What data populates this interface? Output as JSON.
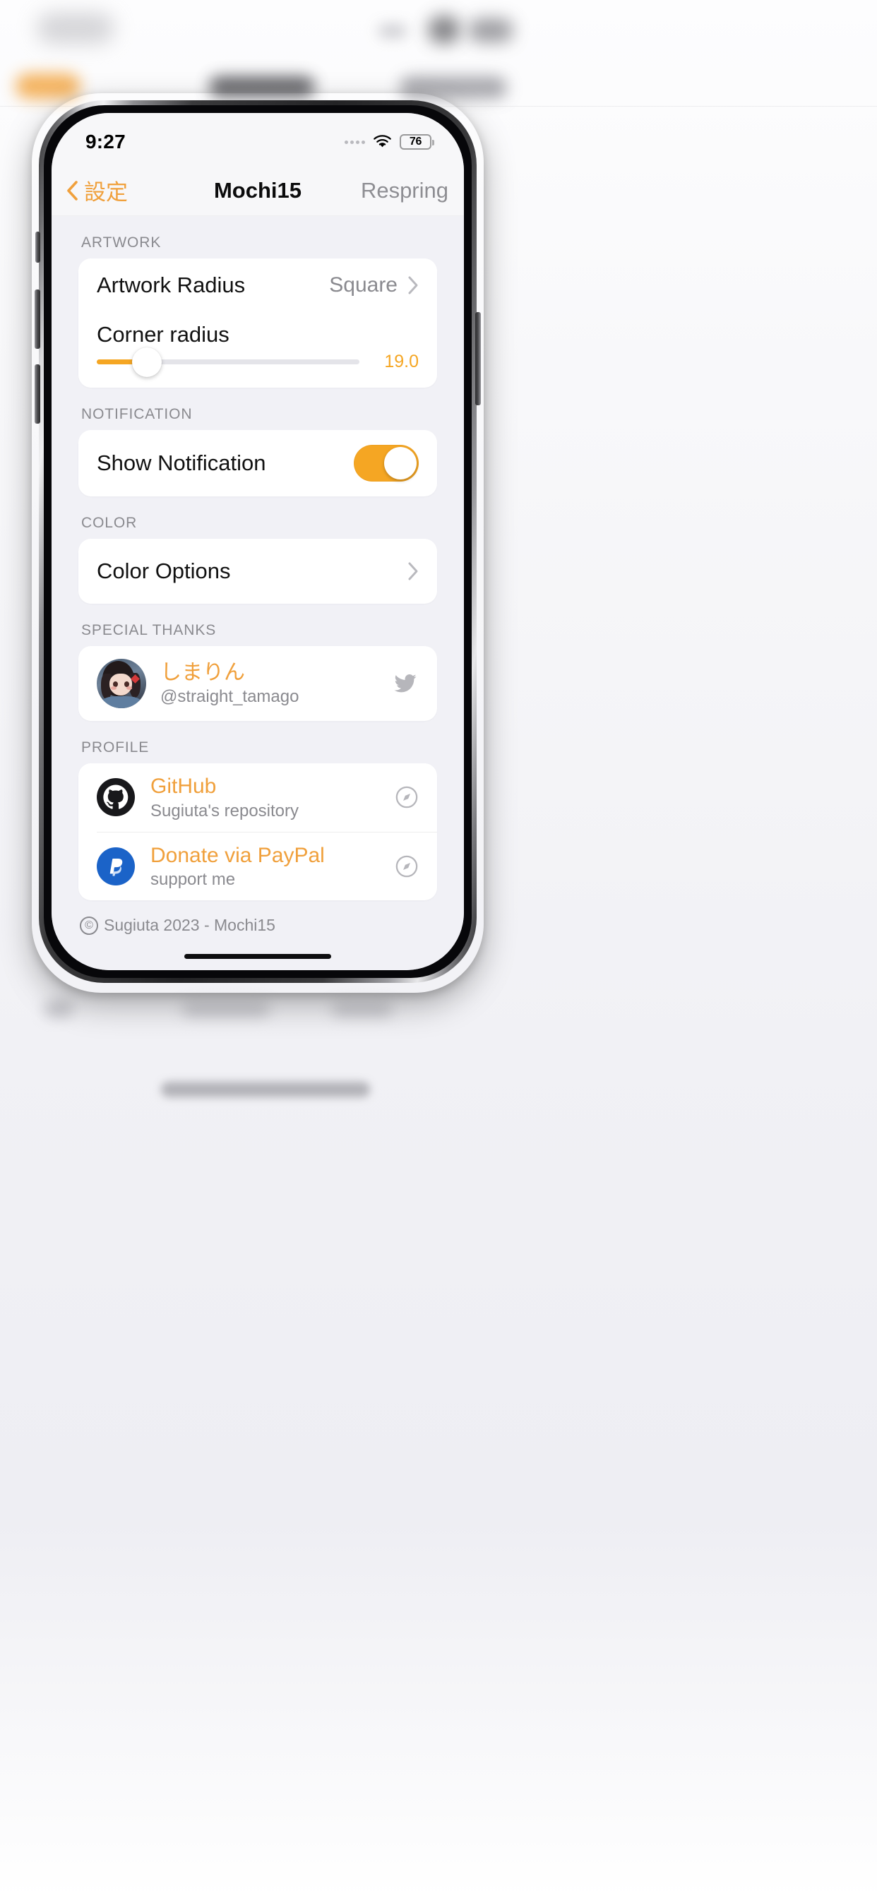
{
  "statusbar": {
    "time": "9:27",
    "signal_icon": "cellular-dots-icon",
    "wifi_icon": "wifi-icon",
    "battery_level": "76"
  },
  "navbar": {
    "back_icon": "chevron-left-icon",
    "back_label": "設定",
    "title": "Mochi15",
    "action_label": "Respring"
  },
  "sections": {
    "artwork": {
      "header": "ARTWORK",
      "artwork_radius": {
        "label": "Artwork Radius",
        "value": "Square",
        "chevron": "chevron-right-icon"
      },
      "corner_radius": {
        "label": "Corner radius",
        "value": "19.0",
        "percent": 19
      }
    },
    "notification": {
      "header": "NOTIFICATION",
      "show_notification": {
        "label": "Show Notification",
        "state": "on"
      }
    },
    "color": {
      "header": "COLOR",
      "color_options": {
        "label": "Color Options",
        "chevron": "chevron-right-icon"
      }
    },
    "special_thanks": {
      "header": "SPECIAL THANKS",
      "person": {
        "avatar": "avatar-shimarin",
        "name": "しまりん",
        "handle": "@straight_tamago",
        "link_icon": "twitter-icon"
      }
    },
    "profile": {
      "header": "PROFILE",
      "items": [
        {
          "icon": "github-icon",
          "title": "GitHub",
          "subtitle": "Sugiuta's repository",
          "link_icon": "safari-compass-icon"
        },
        {
          "icon": "paypal-icon",
          "title": "Donate via PayPal",
          "subtitle": "support me",
          "link_icon": "safari-compass-icon"
        }
      ]
    },
    "footer": {
      "mark": "©",
      "text": "Sugiuta 2023 - Mochi15"
    }
  },
  "colors": {
    "accent": "#F5A623",
    "accent_text": "#F0A03C",
    "secondary_text": "#8a8a8f",
    "background": "#f1f1f6",
    "card": "#ffffff"
  }
}
